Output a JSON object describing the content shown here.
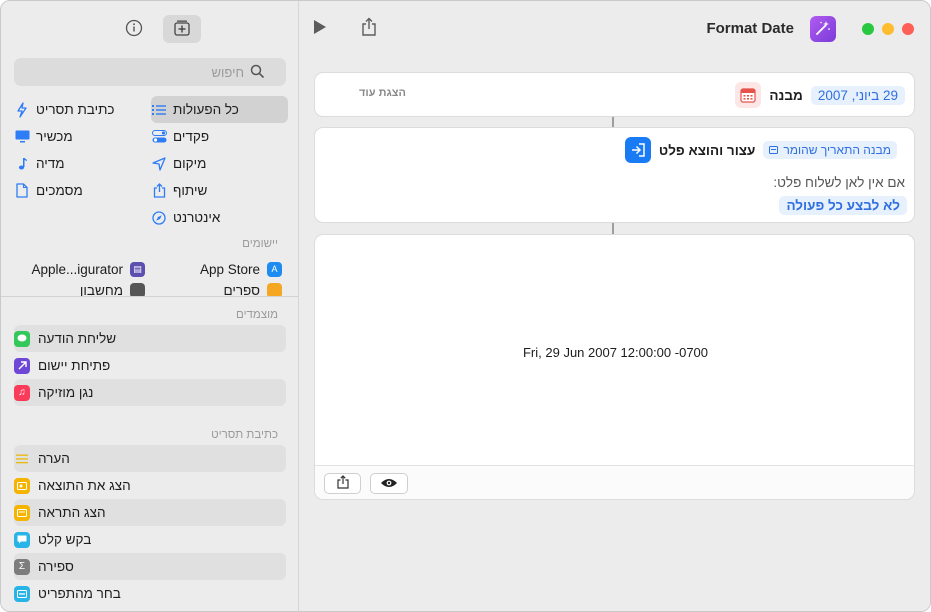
{
  "window": {
    "title": "Format Date",
    "traffic_colors": [
      "#ff5f57",
      "#febc2e",
      "#28c840"
    ]
  },
  "sidebar": {
    "search_placeholder": "חיפוש",
    "categories": [
      [
        {
          "label": "כל הפעולות",
          "icon": "list-icon",
          "selected": true
        },
        {
          "label": "כתיבת תסריט",
          "icon": "scripting-icon"
        }
      ],
      [
        {
          "label": "פקדים",
          "icon": "toggle-icon"
        },
        {
          "label": "מכשיר",
          "icon": "display-icon"
        }
      ],
      [
        {
          "label": "מיקום",
          "icon": "location-arrow-icon"
        },
        {
          "label": "מדיה",
          "icon": "music-note-icon"
        }
      ],
      [
        {
          "label": "שיתוף",
          "icon": "share-icon"
        },
        {
          "label": "מסמכים",
          "icon": "document-icon"
        }
      ],
      [
        {
          "label": "אינטרנט",
          "icon": "compass-icon"
        }
      ]
    ],
    "apps_label": "יישומים",
    "apps": [
      {
        "label": "App Store",
        "icon": "app-store-icon",
        "color": "#1c8cf2"
      },
      {
        "label": "Apple...igurator",
        "icon": "configurator-icon",
        "color": "#5b4fb0"
      }
    ],
    "apps_partial": [
      {
        "label": "ספרים",
        "color": "#f5a623"
      },
      {
        "label": "מחשבון",
        "color": "#555555"
      }
    ],
    "suggested_label": "מוצמדים",
    "suggested": [
      {
        "label": "שליחת הודעה",
        "icon": "messages-icon",
        "color": "#34c759"
      },
      {
        "label": "פתיחת יישום",
        "icon": "open-app-icon",
        "color": "#6e47d6"
      },
      {
        "label": "נגן מוזיקה",
        "icon": "music-icon",
        "color": "#fa3c5a"
      }
    ],
    "scripting_label": "כתיבת תסריט",
    "scripting": [
      {
        "label": "הערה",
        "icon": "comment-lines-icon",
        "color": "#f4c430",
        "plain": true
      },
      {
        "label": "הצג את התוצאה",
        "icon": "show-result-icon",
        "color": "#f4b400"
      },
      {
        "label": "הצג התראה",
        "icon": "alert-icon",
        "color": "#f4b400"
      },
      {
        "label": "בקש קלט",
        "icon": "ask-input-icon",
        "color": "#28b4e6"
      },
      {
        "label": "ספירה",
        "icon": "sigma-icon",
        "color": "#7d7d7d"
      },
      {
        "label": "בחר מהתפריט",
        "icon": "menu-icon",
        "color": "#28b4e6"
      }
    ]
  },
  "editor": {
    "date_action": {
      "label": "מבנה",
      "value": "29 ביוני, 2007",
      "show_more": "הצגת עוד"
    },
    "output_action": {
      "label": "עצור והוצא פלט",
      "variable": "מבנה התאריך שהומר",
      "no_place": "אם אין לאן לשלוח פלט:",
      "no_place_option": "לא לבצע כל פעולה"
    },
    "result": {
      "text": "Fri, 29 Jun 2007 12:00:00 -0700"
    }
  }
}
